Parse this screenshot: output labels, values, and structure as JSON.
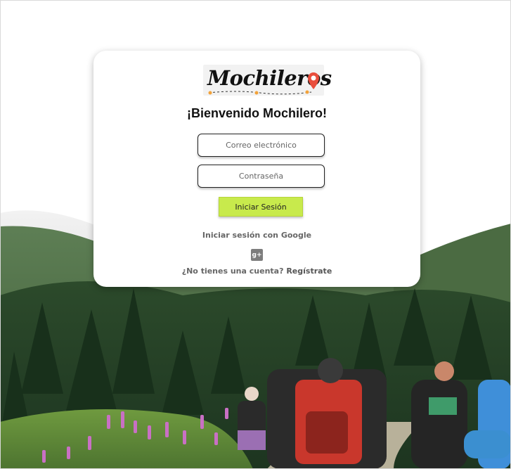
{
  "brand": {
    "logo_text": "Mochileros"
  },
  "login": {
    "welcome_title": "¡Bienvenido Mochilero!",
    "email_placeholder": "Correo electrónico",
    "password_placeholder": "Contraseña",
    "submit_label": "Iniciar Sesión",
    "google_label": "Iniciar sesión con Google",
    "google_icon": "google-plus-icon",
    "google_icon_glyph": "g+",
    "signup_prompt": "¿No tienes una cuenta?",
    "signup_link": "Regístrate"
  },
  "colors": {
    "submit_button": "#c8ea4c",
    "card_background": "#ffffff",
    "pin": "#e94e3c"
  }
}
